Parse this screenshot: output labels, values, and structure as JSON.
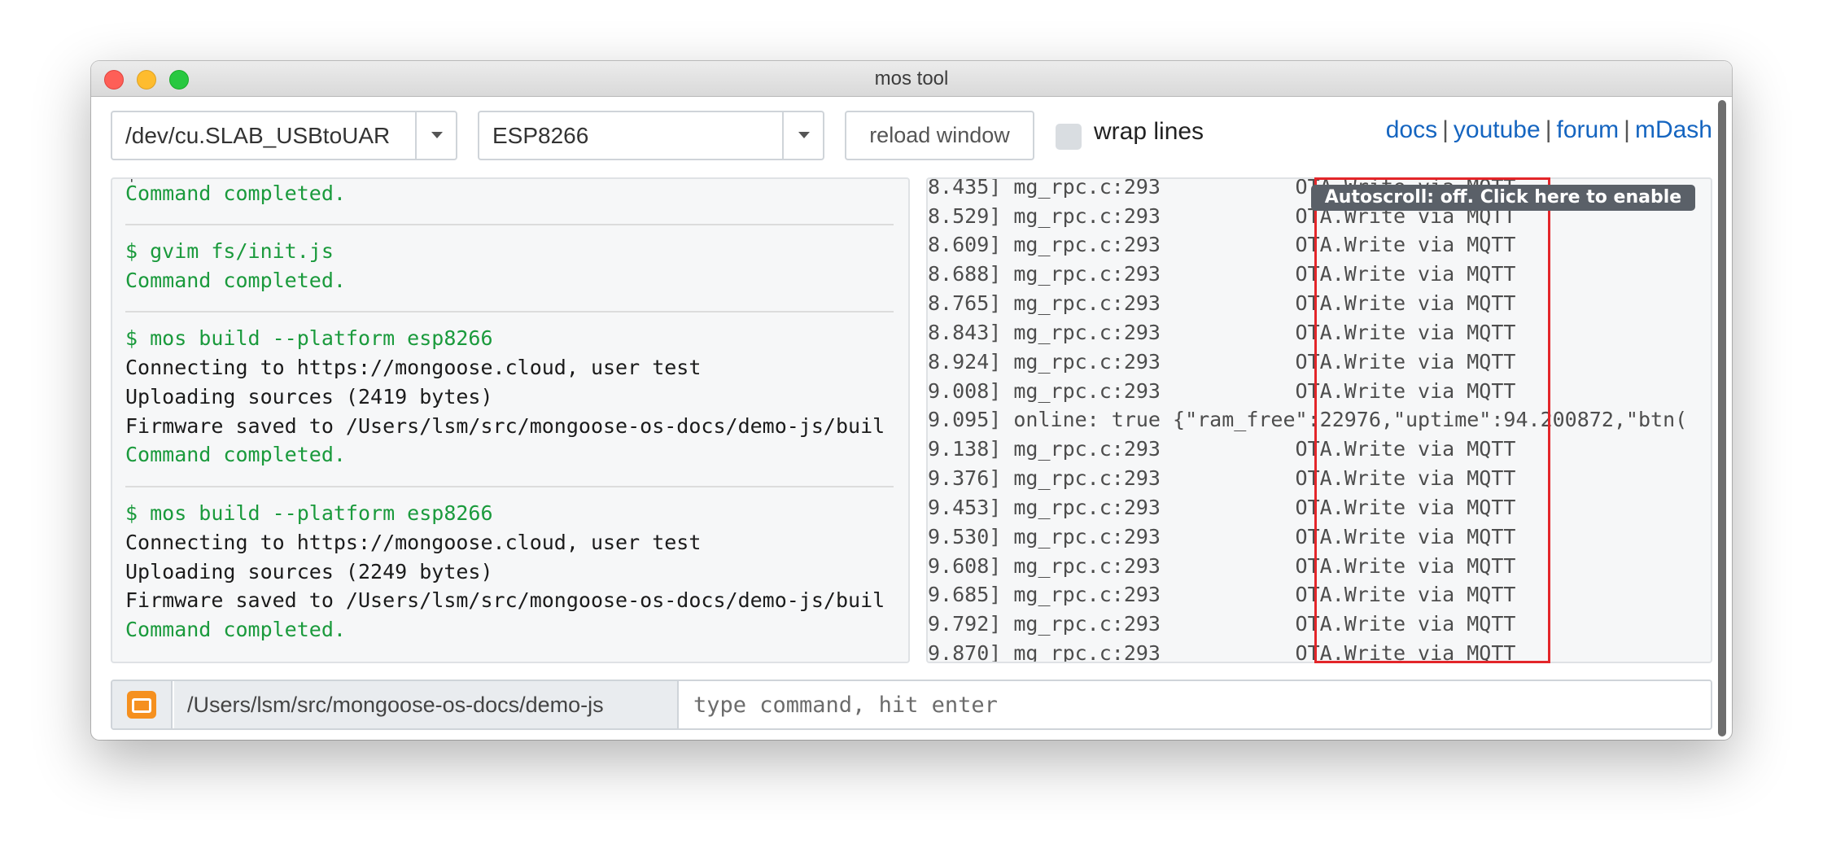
{
  "window": {
    "title": "mos tool"
  },
  "toolbar": {
    "port": "/dev/cu.SLAB_USBtoUAR",
    "board": "ESP8266",
    "reload_label": "reload window",
    "wrap_label": "wrap lines",
    "links": [
      "docs",
      "youtube",
      "forum",
      "mDash"
    ]
  },
  "console": {
    "lines": [
      "Command completed.",
      "$ gvim fs/init.js",
      "Command completed.",
      "$ mos build --platform esp8266",
      "Connecting to https://mongoose.cloud, user test",
      "Uploading sources (2419 bytes)",
      "Firmware saved to /Users/lsm/src/mongoose-os-docs/demo-js/buil",
      "Command completed.",
      "$ mos build --platform esp8266",
      "Connecting to https://mongoose.cloud, user test",
      "Uploading sources (2249 bytes)",
      "Firmware saved to /Users/lsm/src/mongoose-os-docs/demo-js/buil",
      "Command completed."
    ]
  },
  "log": {
    "lines": [
      "8.435] mg_rpc.c:293           OTA.Write via MQTT",
      "8.529] mg_rpc.c:293           OTA.Write via MQTT",
      "8.609] mg_rpc.c:293           OTA.Write via MQTT",
      "8.688] mg_rpc.c:293           OTA.Write via MQTT",
      "8.765] mg_rpc.c:293           OTA.Write via MQTT",
      "8.843] mg_rpc.c:293           OTA.Write via MQTT",
      "8.924] mg_rpc.c:293           OTA.Write via MQTT",
      "9.008] mg_rpc.c:293           OTA.Write via MQTT",
      "9.095] online: true {\"ram_free\":22976,\"uptime\":94.200872,\"btn(",
      "9.138] mg_rpc.c:293           OTA.Write via MQTT",
      "9.376] mg_rpc.c:293           OTA.Write via MQTT",
      "9.453] mg_rpc.c:293           OTA.Write via MQTT",
      "9.530] mg_rpc.c:293           OTA.Write via MQTT",
      "9.608] mg_rpc.c:293           OTA.Write via MQTT",
      "9.685] mg_rpc.c:293           OTA.Write via MQTT",
      "9.792] mg_rpc.c:293           OTA.Write via MQTT",
      "9.870] mg_rpc.c:293           OTA.Write via MQTT"
    ],
    "autoscroll_tooltip": "Autoscroll: off. Click here to enable"
  },
  "command": {
    "cwd": "/Users/lsm/src/mongoose-os-docs/demo-js",
    "placeholder": "type command, hit enter"
  },
  "icons": {
    "folder": "folder-icon",
    "dropdown": "chevron-down-icon"
  },
  "colors": {
    "success": "#1a9a3c",
    "link": "#1565c0",
    "highlight": "#e3262a",
    "folder": "#f5901f"
  }
}
